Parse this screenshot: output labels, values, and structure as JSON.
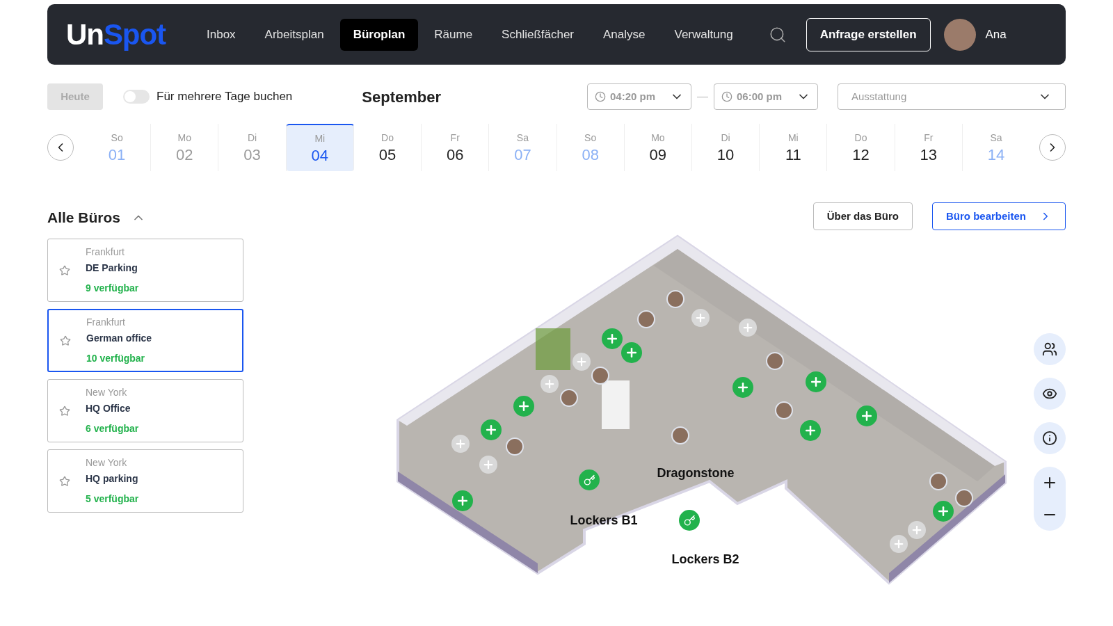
{
  "nav": {
    "logo": {
      "part1": "Un",
      "part2": "Spot"
    },
    "items": [
      {
        "label": "Inbox",
        "selected": false
      },
      {
        "label": "Arbeitsplan",
        "selected": false
      },
      {
        "label": "Büroplan",
        "selected": true
      },
      {
        "label": "Räume",
        "selected": false
      },
      {
        "label": "Schließfächer",
        "selected": false
      },
      {
        "label": "Analyse",
        "selected": false
      },
      {
        "label": "Verwaltung",
        "selected": false
      }
    ],
    "cta": "Anfrage erstellen",
    "user": "Ana"
  },
  "toolbar": {
    "today": {
      "label": "Heute",
      "disabled": true
    },
    "multi_day": {
      "label": "Für mehrere Tage buchen",
      "on": false
    },
    "month": "September",
    "time_from": "04:20 pm",
    "time_to": "06:00 pm",
    "range_separator": "—",
    "equipment": {
      "placeholder": "Ausstattung"
    }
  },
  "days": [
    {
      "weekday": "So",
      "date": "01",
      "kind": "weekend",
      "selected": false
    },
    {
      "weekday": "Mo",
      "date": "02",
      "kind": "past",
      "selected": false
    },
    {
      "weekday": "Di",
      "date": "03",
      "kind": "past",
      "selected": false
    },
    {
      "weekday": "Mi",
      "date": "04",
      "kind": "normal",
      "selected": true
    },
    {
      "weekday": "Do",
      "date": "05",
      "kind": "normal",
      "selected": false
    },
    {
      "weekday": "Fr",
      "date": "06",
      "kind": "normal",
      "selected": false
    },
    {
      "weekday": "Sa",
      "date": "07",
      "kind": "weekend",
      "selected": false
    },
    {
      "weekday": "So",
      "date": "08",
      "kind": "weekend",
      "selected": false
    },
    {
      "weekday": "Mo",
      "date": "09",
      "kind": "normal",
      "selected": false
    },
    {
      "weekday": "Di",
      "date": "10",
      "kind": "normal",
      "selected": false
    },
    {
      "weekday": "Mi",
      "date": "11",
      "kind": "normal",
      "selected": false
    },
    {
      "weekday": "Do",
      "date": "12",
      "kind": "normal",
      "selected": false
    },
    {
      "weekday": "Fr",
      "date": "13",
      "kind": "normal",
      "selected": false
    },
    {
      "weekday": "Sa",
      "date": "14",
      "kind": "weekend",
      "selected": false
    }
  ],
  "offices": {
    "title": "Alle Büros",
    "expanded": true,
    "items": [
      {
        "city": "Frankfurt",
        "name": "DE Parking",
        "available": "9 verfügbar",
        "selected": false
      },
      {
        "city": "Frankfurt",
        "name": "German office",
        "available": "10 verfügbar",
        "selected": true
      },
      {
        "city": "New York",
        "name": "HQ Office",
        "available": "6 verfügbar",
        "selected": false
      },
      {
        "city": "New York",
        "name": "HQ parking",
        "available": "5 verfügbar",
        "selected": false
      }
    ]
  },
  "plan": {
    "about_button": "Über das Büro",
    "edit_button": "Büro bearbeiten",
    "labels": [
      "Dragonstone",
      "Lockers B1",
      "Lockers B2"
    ]
  }
}
